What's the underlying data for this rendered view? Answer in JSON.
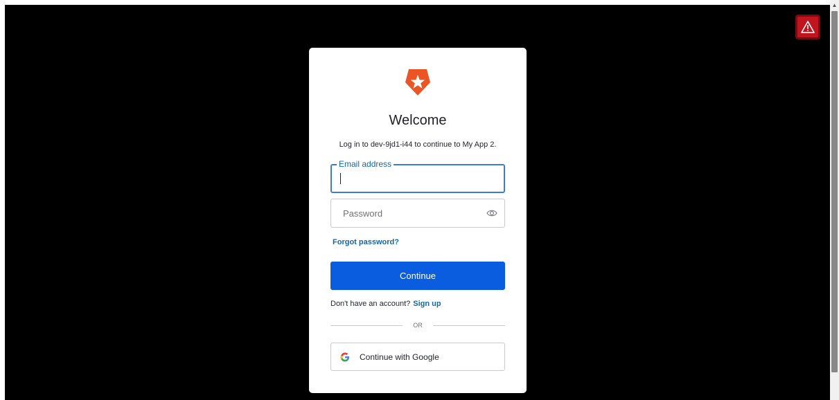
{
  "login": {
    "title": "Welcome",
    "subtitle": "Log in to dev-9jd1-i44 to continue to My App 2.",
    "email_label": "Email address",
    "email_value": "",
    "password_placeholder": "Password",
    "forgot_label": "Forgot password?",
    "continue_label": "Continue",
    "no_account_text": "Don't have an account?",
    "signup_label": "Sign up",
    "or_label": "OR",
    "google_label": "Continue with Google"
  },
  "icons": {
    "logo": "auth0-star-shield-icon",
    "password_toggle": "eye-icon",
    "google": "google-g-icon",
    "warning": "warning-triangle-icon",
    "scroll_up": "chevron-up-icon"
  },
  "colors": {
    "brand": "#eb5424",
    "primary_button": "#0a5ddf",
    "link": "#1367a6",
    "warning": "#c0141e"
  }
}
